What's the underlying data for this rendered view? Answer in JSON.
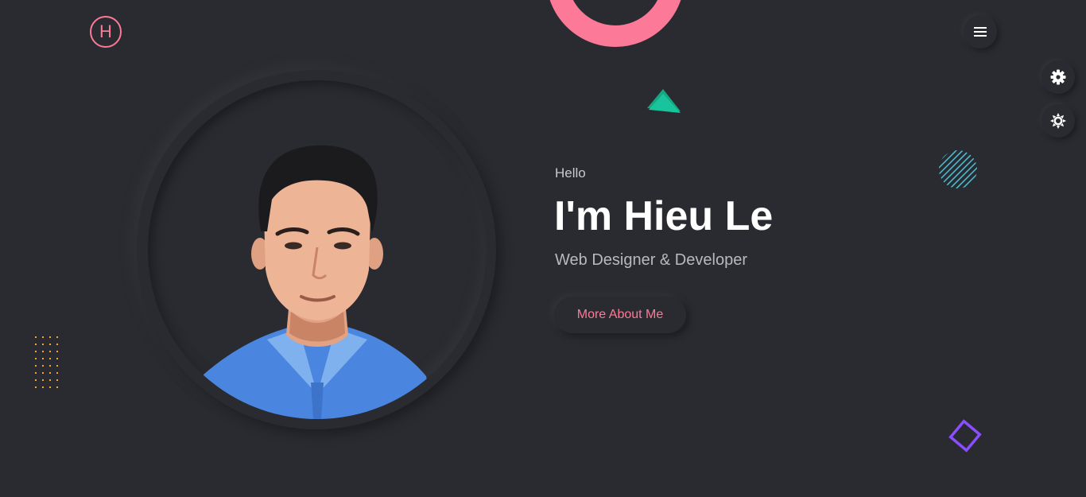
{
  "header": {
    "logo_letter": "H",
    "menu_icon": "hamburger-menu-icon"
  },
  "side_controls": {
    "settings_icon": "gear-icon",
    "theme_icon": "sun-icon"
  },
  "hero": {
    "greeting": "Hello",
    "title": "I'm Hieu Le",
    "subtitle": "Web Designer & Developer",
    "cta_label": "More About Me"
  },
  "colors": {
    "background": "#2a2b30",
    "accent_pink": "#fc7a97",
    "accent_green": "#19c39b",
    "accent_cyan": "#4fc3d9",
    "accent_purple": "#8a4dff",
    "accent_orange": "#f5a623"
  }
}
